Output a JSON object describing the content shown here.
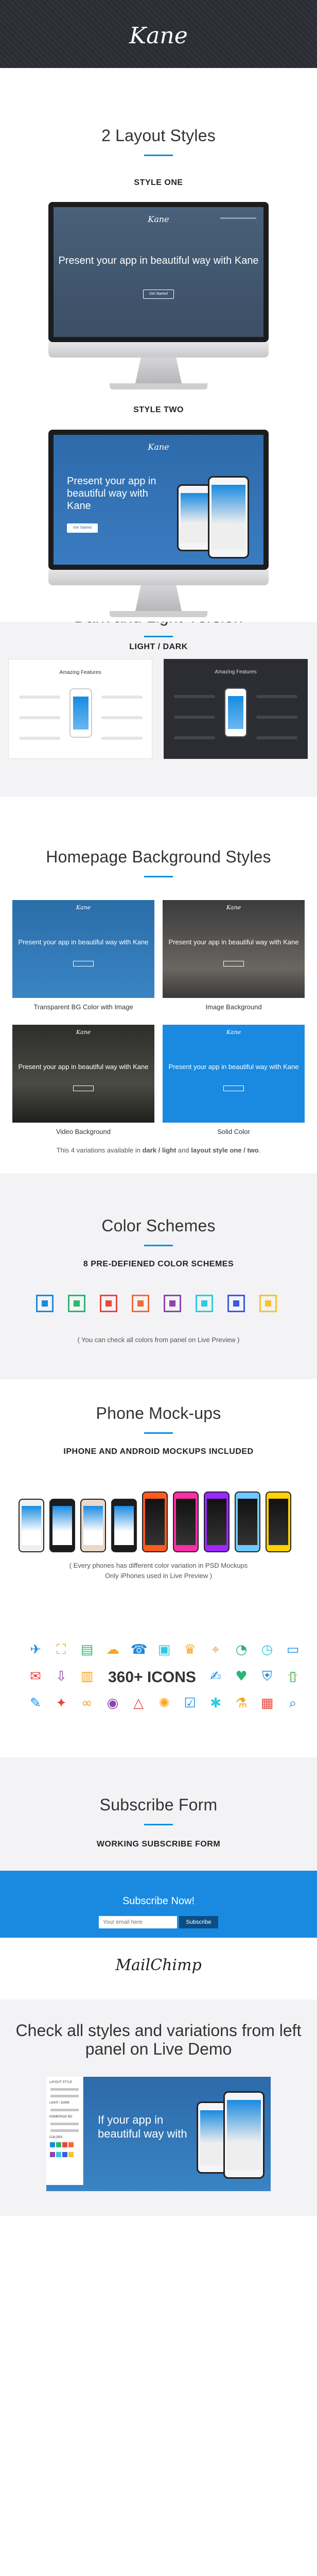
{
  "header": {
    "logo": "Kane"
  },
  "layout": {
    "title": "2 Layout Styles",
    "style_one_label": "STYLE ONE",
    "style_two_label": "STYLE TWO",
    "hero_text_one": "Present your app in beautiful way with Kane",
    "hero_text_two": "Present your app in beautiful way with Kane",
    "hero_button": "Get Started"
  },
  "versions": {
    "title": "Dark and Light Version",
    "label": "LIGHT / DARK",
    "preview_title": "Amazing Features"
  },
  "backgrounds": {
    "title": "Homepage Background Styles",
    "items": [
      {
        "caption": "Transparent BG Color with Image",
        "text": "Present your app in beautiful way with Kane"
      },
      {
        "caption": "Image Background",
        "text": "Present your app in beautiful way with Kane"
      },
      {
        "caption": "Video Background",
        "text": "Present your app in beautiful way with Kane"
      },
      {
        "caption": "Solid Color",
        "text": "Present your app in beautiful way with Kane"
      }
    ],
    "note_pre": "This 4 variations available in ",
    "note_bold1": "dark / light",
    "note_mid": " and ",
    "note_bold2": "layout style one / two",
    "note_post": "."
  },
  "colors": {
    "title": "Color Schemes",
    "subtitle": "8 PRE-DEFIENED COLOR SCHEMES",
    "note": "( You can check all colors from panel on Live Preview )",
    "swatches": [
      "#1a8ae0",
      "#2bb673",
      "#e8483b",
      "#f26b38",
      "#8e44ad",
      "#2ecbe0",
      "#3b5bdb",
      "#f4c430"
    ]
  },
  "mockups": {
    "title": "Phone Mock-ups",
    "subtitle": "IPHONE AND ANDROID MOCKUPS INCLUDED",
    "note_line1": "( Every phones has different color variation in PSD Mockups",
    "note_line2": "Only iPhones used in Live Preview )",
    "phone_colors": [
      "#f0f0f0",
      "#1c1c1c",
      "#e9d9c8",
      "#1c1c1c",
      "#ff5a1f",
      "#ff2ea6",
      "#9c27ff",
      "#6fc8ff",
      "#ffd200"
    ]
  },
  "icons": {
    "label": "360+ ICONS",
    "colors": {
      "orange": "#f5a623",
      "blue": "#1a8ae0",
      "green": "#2bb673",
      "red": "#e8483b",
      "purple": "#8e44ad",
      "teal": "#2ecbe0"
    }
  },
  "subscribe": {
    "title": "Subscribe Form",
    "subtitle": "WORKING SUBSCRIBE FORM",
    "box_title": "Subscribe Now!",
    "placeholder": "Your email here",
    "button": "Subscribe",
    "mailchimp": "MailChimp"
  },
  "demo": {
    "heading_line1": "Check all styles and variations from left",
    "heading_line2": "panel on Live Demo",
    "hero_text": "If your app in beautiful way with",
    "panel_labels": [
      "LAYOUT STYLE",
      "LIGHT / DARK",
      "HOMEPAGE BG",
      "COLORS"
    ]
  }
}
